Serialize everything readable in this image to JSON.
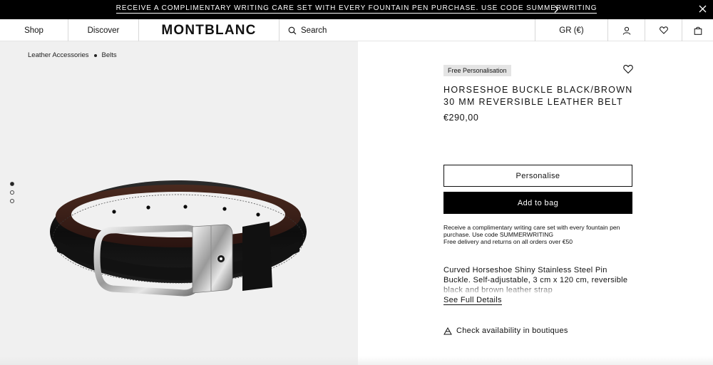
{
  "promo": {
    "text": "RECEIVE A COMPLIMENTARY WRITING CARE SET WITH EVERY FOUNTAIN PEN PURCHASE. USE CODE SUMMERWRITING"
  },
  "nav": {
    "shop": "Shop",
    "discover": "Discover",
    "logo": "MONTBLANC",
    "search": "Search",
    "region": "GR (€)"
  },
  "breadcrumb": [
    "Leather Accessories",
    "Belts"
  ],
  "gallery": {
    "image_count": 3,
    "active_index": 0
  },
  "product": {
    "badge": "Free Personalisation",
    "title": "HORSESHOE BUCKLE BLACK/BROWN 30 MM REVERSIBLE LEATHER BELT",
    "price": "€290,00",
    "personalise_label": "Personalise",
    "add_to_bag_label": "Add to bag",
    "info_line1": "Receive a complimentary writing care set with every fountain pen purchase. Use code SUMMERWRITING",
    "info_line2": "Free delivery and returns on all orders over €50",
    "description": "Curved Horseshoe Shiny Stainless Steel Pin Buckle. Self-adjustable, 3 cm x 120 cm, reversible black and brown leather strap",
    "see_details": "See Full Details",
    "availability": "Check availability in boutiques"
  },
  "icons": {
    "promo_next": "chevron-right-icon",
    "promo_close": "close-icon",
    "search": "search-icon",
    "account": "user-icon",
    "wishlist": "heart-icon",
    "bag": "bag-icon",
    "product_wishlist": "heart-icon",
    "boutique": "boutique-icon"
  },
  "colors": {
    "promo_bg": "#000000",
    "gallery_bg": "#f0f0f0",
    "badge_bg": "#e4e4e4",
    "primary_button": "#000000"
  }
}
